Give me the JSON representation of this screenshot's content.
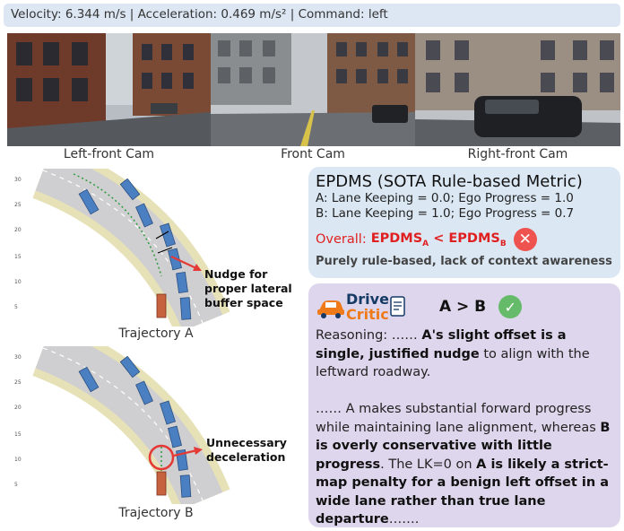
{
  "status": {
    "velocity": "Velocity: 6.344 m/s",
    "acceleration": "Acceleration: 0.469 m/s²",
    "command": "Command: left",
    "separator": " | "
  },
  "cameras": [
    {
      "label": "Left-front Cam"
    },
    {
      "label": "Front Cam"
    },
    {
      "label": "Right-front Cam"
    }
  ],
  "trajectories": {
    "a": {
      "label": "Trajectory A",
      "annotation_lines": [
        "Nudge for",
        "proper lateral",
        "buffer space"
      ],
      "y_ticks": [
        "30",
        "25",
        "20",
        "15",
        "10",
        "5"
      ]
    },
    "b": {
      "label": "Trajectory B",
      "annotation_lines": [
        "Unnecessary",
        "deceleration"
      ],
      "y_ticks": [
        "30",
        "25",
        "20",
        "15",
        "10",
        "5"
      ]
    }
  },
  "epdms": {
    "title": "EPDMS (SOTA Rule-based Metric)",
    "line_a": "A: Lane Keeping = 0.0; Ego Progress = 1.0",
    "line_b": "B: Lane Keeping = 1.0; Ego Progress = 0.7",
    "overall_label": "Overall:",
    "metric": "EPDMS",
    "sub_a": "A",
    "lt": " < ",
    "sub_b": "B",
    "badge": "✕",
    "note": "Purely rule-based, lack of context awareness"
  },
  "critic": {
    "logo_line1": "Drive",
    "logo_line2": "Critic",
    "verdict": "A > B",
    "badge": "✓",
    "reasoning": [
      {
        "t": "Reasoning: …… ",
        "b": false
      },
      {
        "t": "A's slight offset is a single, justified nudge",
        "b": true
      },
      {
        "t": " to align with the leftward roadway.",
        "b": false
      },
      {
        "t": "BR",
        "b": false
      },
      {
        "t": "…… A makes substantial forward progress while maintaining lane alignment, whereas ",
        "b": false
      },
      {
        "t": "B is overly conservative with little progress",
        "b": true
      },
      {
        "t": ". The LK=0 on ",
        "b": false
      },
      {
        "t": "A is likely a strict-map penalty for a benign left offset in a wide lane rather than true lane departure",
        "b": true
      },
      {
        "t": "…….",
        "b": false
      }
    ]
  },
  "colors": {
    "status_bg": "#dde7f3",
    "epdms_bg": "#dbe8f4",
    "critic_bg": "#ddd6ec",
    "accent_red": "#e02020",
    "check_green": "#66bb6a"
  }
}
